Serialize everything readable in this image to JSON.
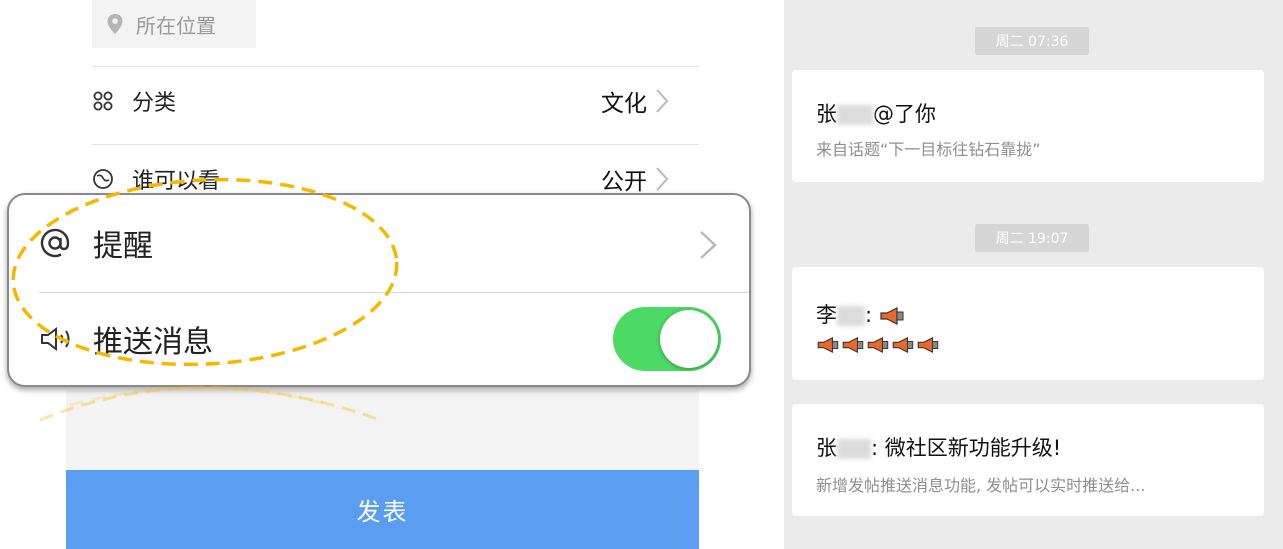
{
  "form": {
    "location_placeholder": "所在位置",
    "category_label": "分类",
    "category_value": "文化",
    "visibility_label": "谁可以看",
    "visibility_value": "公开",
    "submit_label": "发表"
  },
  "zoom": {
    "remind_label": "提醒",
    "push_label": "推送消息",
    "push_enabled": true
  },
  "notifications": [
    {
      "time": "周二 07:36",
      "title_prefix": "张",
      "title_suffix": "@了你",
      "subtitle": "来自话题“下一目标往钻石靠拢”"
    },
    {
      "time": "周二 19:07",
      "title_prefix": "李",
      "title_suffix": ":"
    },
    {
      "title_prefix": "张",
      "title_suffix": ": 微社区新功能升级!",
      "subtitle": "新增发帖推送消息功能, 发帖可以实时推送给..."
    }
  ],
  "colors": {
    "accent_blue": "#5b9df0",
    "toggle_green": "#4cd964",
    "highlight_yellow": "#f5b800"
  },
  "icons": [
    "location-pin-icon",
    "category-grid-icon",
    "visibility-icon",
    "chevron-right-icon",
    "at-icon",
    "speaker-icon",
    "megaphone-icon"
  ]
}
